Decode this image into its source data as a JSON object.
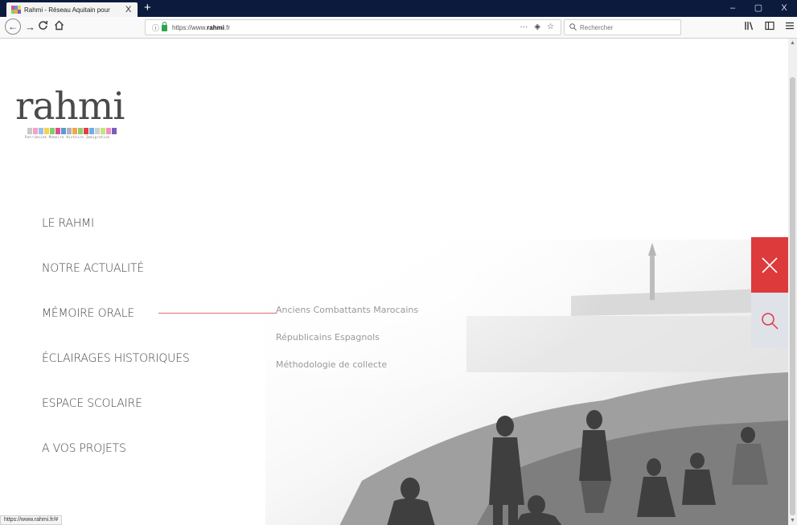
{
  "browser": {
    "tab_title": "Rahmi - Réseau Aquitain pour",
    "tab_close": "X",
    "new_tab": "+",
    "window_controls": {
      "minimize": "–",
      "restore": "▢",
      "close": "X"
    },
    "url_prefix": "https://www.",
    "url_domain": "rahmi",
    "url_suffix": ".fr",
    "url_actions": {
      "more": "···",
      "pocket": "◈",
      "bookmark": "☆"
    },
    "search_placeholder": "Rechercher",
    "status_text": "https://www.rahmi.fr/#"
  },
  "logo": {
    "wordmark": "rahmi",
    "tagline": "Patrimoine Mémoire Histoire Immigration",
    "square_colors": [
      "#c9c9c9",
      "#f2a2c5",
      "#98c0e9",
      "#f5d34f",
      "#7fcf6a",
      "#e44b8d",
      "#5b9ad5",
      "#b2b2b2",
      "#f6a34b",
      "#8fcf6f",
      "#e93e3e",
      "#6ab0e8",
      "#d0d0d0",
      "#c3e57c",
      "#f38fc0",
      "#7a5fba"
    ]
  },
  "menu": {
    "items": [
      {
        "label": "LE RAHMI"
      },
      {
        "label": "NOTRE ACTUALITÉ"
      },
      {
        "label": "MÉMOIRE ORALE"
      },
      {
        "label": "ÉCLAIRAGES HISTORIQUES"
      },
      {
        "label": "ESPACE SCOLAIRE"
      },
      {
        "label": "A VOS PROJETS"
      }
    ],
    "active_index": 2,
    "underline_color": "#d96b75"
  },
  "submenu": {
    "items": [
      {
        "label": "Anciens Combattants Marocains"
      },
      {
        "label": "Républicains Espagnols"
      },
      {
        "label": "Méthodologie de collecte"
      }
    ]
  },
  "side_actions": {
    "close_icon": "close-icon",
    "search_icon": "search-icon",
    "close_color": "#dd3a3c",
    "search_color": "#dfe2e8"
  }
}
